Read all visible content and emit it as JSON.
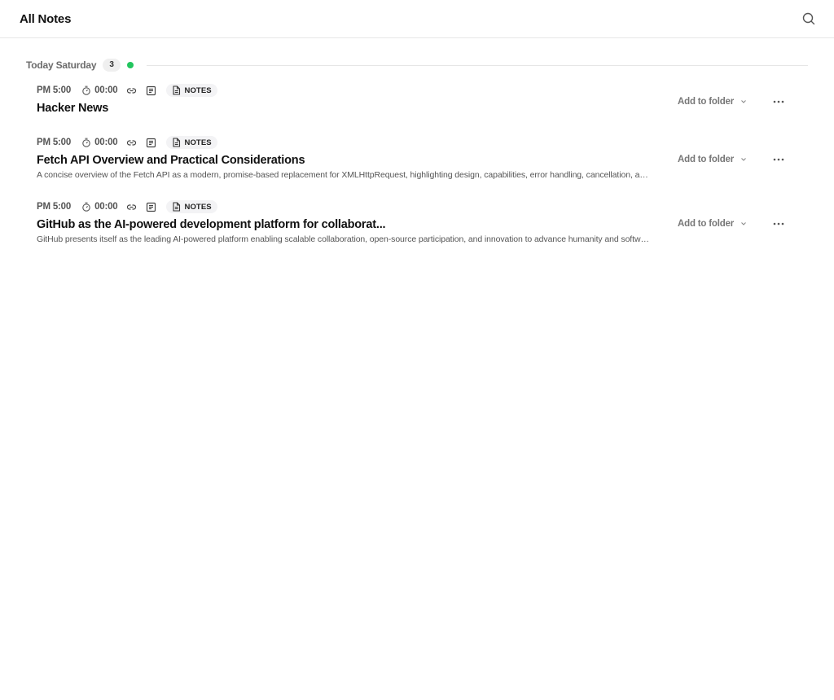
{
  "header": {
    "title": "All Notes",
    "search_icon": "search-icon"
  },
  "group": {
    "label": "Today Saturday",
    "count": "3",
    "dot_color": "#22c55e"
  },
  "notes": [
    {
      "time": "PM 5:00",
      "duration": "00:00",
      "tag": "NOTES",
      "title": "Hacker News",
      "description": "",
      "folder_label": "Add to folder"
    },
    {
      "time": "PM 5:00",
      "duration": "00:00",
      "tag": "NOTES",
      "title": "Fetch API Overview and Practical Considerations",
      "description": "A concise overview of the Fetch API as a modern, promise-based replacement for XMLHttpRequest, highlighting design, capabilities, error handling, cancellation, and practical considerations",
      "folder_label": "Add to folder"
    },
    {
      "time": "PM 5:00",
      "duration": "00:00",
      "tag": "NOTES",
      "title": "GitHub as the AI-powered development platform for collaborat...",
      "description": "GitHub presents itself as the leading AI-powered platform enabling scalable collaboration, open-source participation, and innovation to advance humanity and software development",
      "folder_label": "Add to folder"
    }
  ]
}
